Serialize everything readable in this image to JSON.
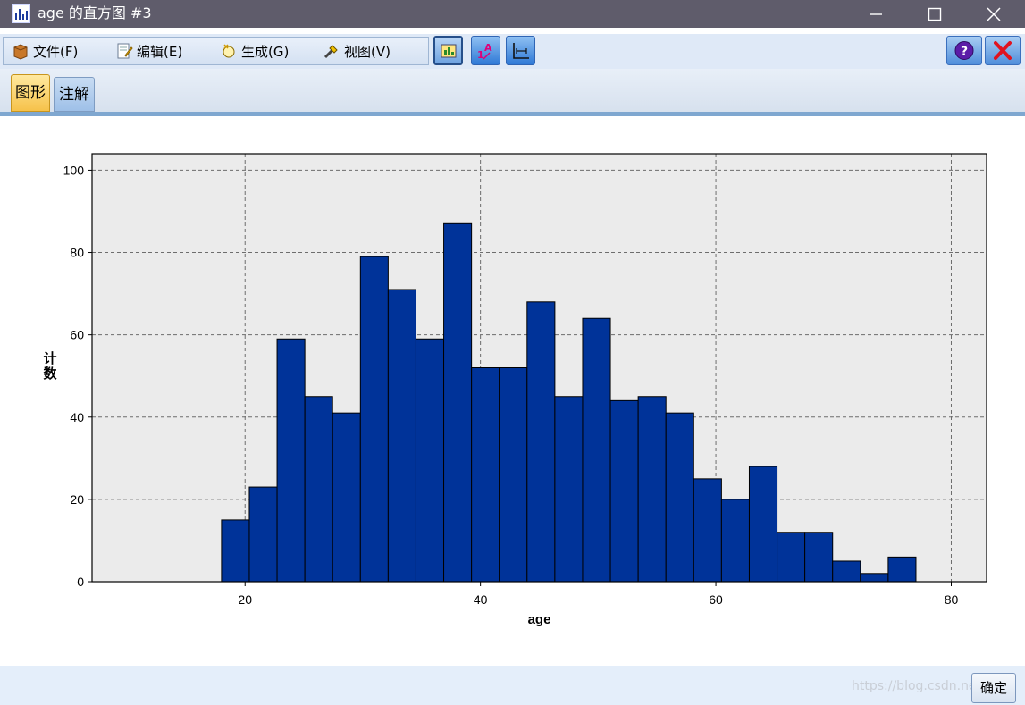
{
  "window": {
    "title": "age 的直方图 #3",
    "icon": "bar-chart-icon",
    "controls": {
      "minimize": "minimize-icon",
      "maximize": "maximize-icon",
      "close": "close-icon"
    }
  },
  "menu": {
    "items": [
      {
        "label": "文件(F)",
        "icon": "file-icon"
      },
      {
        "label": "编辑(E)",
        "icon": "edit-icon"
      },
      {
        "label": "生成(G)",
        "icon": "generate-icon"
      },
      {
        "label": "视图(V)",
        "icon": "view-icon"
      }
    ]
  },
  "toolbar": {
    "buttons": [
      "explore-mode-icon",
      "label-edit-icon",
      "axis-edit-icon"
    ],
    "help_icon": "help-icon",
    "close_icon": "close-icon"
  },
  "tabs": [
    {
      "label": "图形",
      "active": true
    },
    {
      "label": "注解",
      "active": false
    }
  ],
  "chart_data": {
    "type": "bar",
    "subtype": "histogram",
    "xlabel": "age",
    "ylabel": "计数",
    "xlim": [
      7,
      83
    ],
    "ylim": [
      0,
      104
    ],
    "xticks": [
      20,
      40,
      60,
      80
    ],
    "yticks": [
      0,
      20,
      40,
      60,
      80,
      100
    ],
    "grid": true,
    "bar_color": "#003399",
    "bin_width": 2.36,
    "bins": [
      {
        "start": 18.0,
        "count": 15
      },
      {
        "start": 20.36,
        "count": 23
      },
      {
        "start": 22.72,
        "count": 59
      },
      {
        "start": 25.08,
        "count": 45
      },
      {
        "start": 27.44,
        "count": 41
      },
      {
        "start": 29.8,
        "count": 79
      },
      {
        "start": 32.16,
        "count": 71
      },
      {
        "start": 34.52,
        "count": 59
      },
      {
        "start": 36.88,
        "count": 87
      },
      {
        "start": 39.24,
        "count": 52
      },
      {
        "start": 41.6,
        "count": 52
      },
      {
        "start": 43.96,
        "count": 68
      },
      {
        "start": 46.32,
        "count": 45
      },
      {
        "start": 48.68,
        "count": 64
      },
      {
        "start": 51.04,
        "count": 44
      },
      {
        "start": 53.4,
        "count": 45
      },
      {
        "start": 55.76,
        "count": 41
      },
      {
        "start": 58.12,
        "count": 25
      },
      {
        "start": 60.48,
        "count": 20
      },
      {
        "start": 62.84,
        "count": 28
      },
      {
        "start": 65.2,
        "count": 12
      },
      {
        "start": 67.56,
        "count": 12
      },
      {
        "start": 69.92,
        "count": 5
      },
      {
        "start": 72.28,
        "count": 2
      },
      {
        "start": 74.64,
        "count": 6
      }
    ]
  },
  "footer": {
    "ok_label": "确定",
    "watermark": "https://blog.csdn.net/..."
  }
}
